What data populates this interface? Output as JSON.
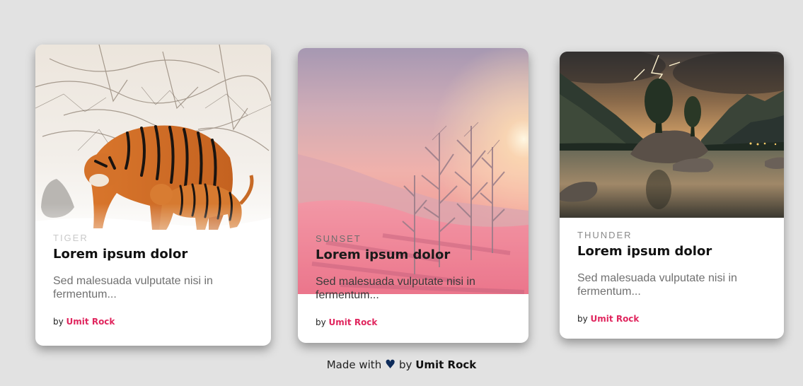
{
  "cards": [
    {
      "category": "TIGER",
      "title": "Lorem ipsum dolor",
      "description": "Sed malesuada vulputate nisi in fermentum...",
      "author_prefix": "by",
      "author": "Umit Rock"
    },
    {
      "category": "SUNSET",
      "title": "Lorem ipsum dolor",
      "description": "Sed malesuada vulputate nisi in fermentum...",
      "author_prefix": "by",
      "author": "Umit Rock"
    },
    {
      "category": "THUNDER",
      "title": "Lorem ipsum dolor",
      "description": "Sed malesuada vulputate nisi in fermentum...",
      "author_prefix": "by",
      "author": "Umit Rock"
    }
  ],
  "footer": {
    "made_with": "Made with",
    "heart_icon": "heart-icon",
    "by": "by",
    "author": "Umit Rock"
  },
  "colors": {
    "background": "#e2e2e2",
    "author_link": "#e0265e",
    "heart": "#0d2b5a"
  }
}
